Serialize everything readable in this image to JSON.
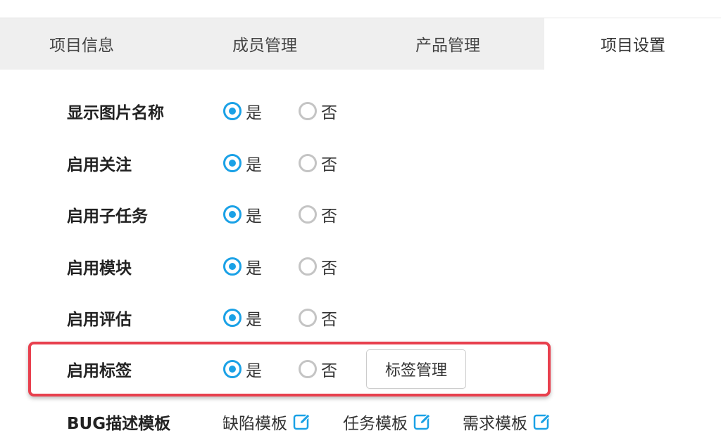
{
  "tabs": [
    {
      "label": "项目信息",
      "active": false
    },
    {
      "label": "成员管理",
      "active": false
    },
    {
      "label": "产品管理",
      "active": false
    },
    {
      "label": "项目设置",
      "active": true
    }
  ],
  "settings": {
    "yes_label": "是",
    "no_label": "否",
    "rows": [
      {
        "label": "显示图片名称",
        "selected": "是"
      },
      {
        "label": "启用关注",
        "selected": "是"
      },
      {
        "label": "启用子任务",
        "selected": "是"
      },
      {
        "label": "启用模块",
        "selected": "是"
      },
      {
        "label": "启用评估",
        "selected": "是"
      },
      {
        "label": "启用标签",
        "selected": "是",
        "button": "标签管理"
      }
    ],
    "bug_template": {
      "label": "BUG描述模板",
      "links": [
        "缺陷模板",
        "任务模板",
        "需求模板"
      ]
    }
  },
  "colors": {
    "accent": "#1aa1e6",
    "highlight_border": "#e8404e",
    "tab_inactive_bg": "#efefef"
  },
  "icons": {
    "edit": "edit-icon"
  }
}
